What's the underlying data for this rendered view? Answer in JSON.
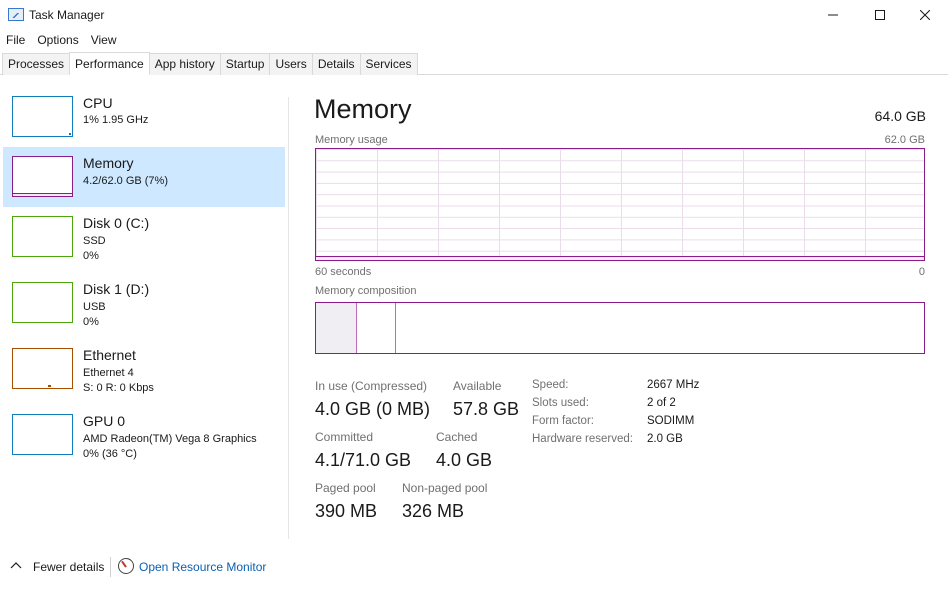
{
  "window": {
    "title": "Task Manager",
    "icon": "task-manager-icon"
  },
  "menu": [
    "File",
    "Options",
    "View"
  ],
  "tabs": [
    "Processes",
    "Performance",
    "App history",
    "Startup",
    "Users",
    "Details",
    "Services"
  ],
  "active_tab": "Performance",
  "sidebar": [
    {
      "title": "CPU",
      "sub1": "1%  1.95 GHz",
      "sub2": "",
      "color": "#117dbb"
    },
    {
      "title": "Memory",
      "sub1": "4.2/62.0 GB (7%)",
      "sub2": "",
      "color": "#8b1a8b"
    },
    {
      "title": "Disk 0 (C:)",
      "sub1": "SSD",
      "sub2": "0%",
      "color": "#4da60c"
    },
    {
      "title": "Disk 1 (D:)",
      "sub1": "USB",
      "sub2": "0%",
      "color": "#4da60c"
    },
    {
      "title": "Ethernet",
      "sub1": "Ethernet 4",
      "sub2": "S: 0  R: 0 Kbps",
      "color": "#a74f01"
    },
    {
      "title": "GPU 0",
      "sub1": "AMD Radeon(TM) Vega 8 Graphics",
      "sub2": "0%  (36 °C)",
      "color": "#117dbb"
    }
  ],
  "main": {
    "title": "Memory",
    "total": "64.0 GB",
    "usage_label": "Memory usage",
    "usage_max": "62.0 GB",
    "time_left": "60 seconds",
    "time_right": "0",
    "composition_label": "Memory composition",
    "usage_fraction": 0.068,
    "composition": {
      "in_use_fraction": 0.068,
      "modified_fraction": 0.064
    }
  },
  "stats": {
    "in_use_label": "In use (Compressed)",
    "in_use_value": "4.0 GB (0 MB)",
    "available_label": "Available",
    "available_value": "57.8 GB",
    "committed_label": "Committed",
    "committed_value": "4.1/71.0 GB",
    "cached_label": "Cached",
    "cached_value": "4.0 GB",
    "paged_label": "Paged pool",
    "paged_value": "390 MB",
    "nonpaged_label": "Non-paged pool",
    "nonpaged_value": "326 MB"
  },
  "details": [
    {
      "key": "Speed:",
      "value": "2667 MHz"
    },
    {
      "key": "Slots used:",
      "value": "2 of 2"
    },
    {
      "key": "Form factor:",
      "value": "SODIMM"
    },
    {
      "key": "Hardware reserved:",
      "value": "2.0 GB"
    }
  ],
  "footer": {
    "fewer_details": "Fewer details",
    "open_resmon": "Open Resource Monitor"
  },
  "colors": {
    "memory": "#8b1a8b",
    "selected_bg": "#cde8ff",
    "link": "#0b5fb3"
  }
}
